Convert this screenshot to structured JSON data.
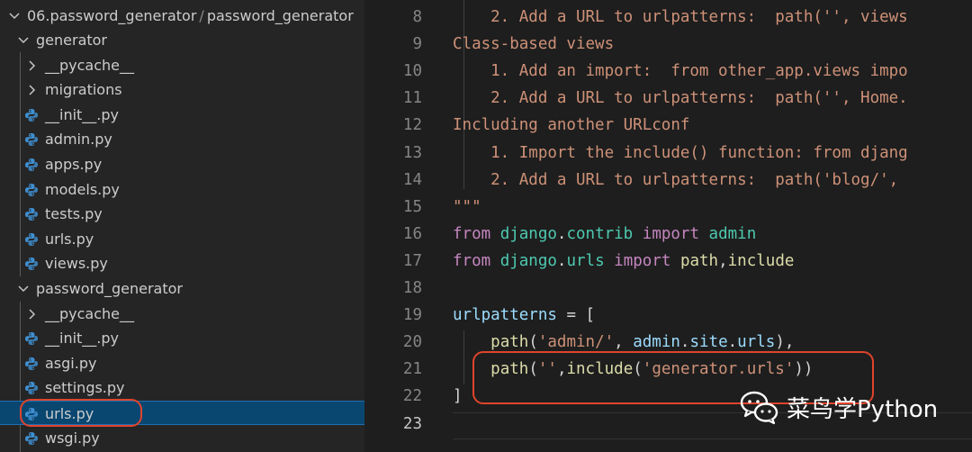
{
  "explorer": {
    "root_label": "06.password_generator",
    "root_label_sep": "/",
    "root_label_tail": "password_generator",
    "items": [
      {
        "label": "generator",
        "kind": "folder-open"
      },
      {
        "label": "__pycache__",
        "kind": "folder-closed"
      },
      {
        "label": "migrations",
        "kind": "folder-closed"
      },
      {
        "label": "__init__.py",
        "kind": "python-file"
      },
      {
        "label": "admin.py",
        "kind": "python-file"
      },
      {
        "label": "apps.py",
        "kind": "python-file"
      },
      {
        "label": "models.py",
        "kind": "python-file"
      },
      {
        "label": "tests.py",
        "kind": "python-file"
      },
      {
        "label": "urls.py",
        "kind": "python-file"
      },
      {
        "label": "views.py",
        "kind": "python-file"
      },
      {
        "label": "password_generator",
        "kind": "folder-open"
      },
      {
        "label": "__pycache__",
        "kind": "folder-closed"
      },
      {
        "label": "__init__.py",
        "kind": "python-file"
      },
      {
        "label": "asgi.py",
        "kind": "python-file"
      },
      {
        "label": "settings.py",
        "kind": "python-file"
      },
      {
        "label": "urls.py",
        "kind": "python-file",
        "selected": true
      },
      {
        "label": "wsgi.py",
        "kind": "python-file"
      }
    ]
  },
  "editor": {
    "lines": [
      {
        "num": "8",
        "t": [
          "    2. Add a URL to urlpatterns:  path('', views"
        ]
      },
      {
        "num": "9",
        "t": [
          "Class-based views"
        ]
      },
      {
        "num": "10",
        "t": [
          "    1. Add an import:  from other_app.views impo"
        ]
      },
      {
        "num": "11",
        "t": [
          "    2. Add a URL to urlpatterns:  path('', Home."
        ]
      },
      {
        "num": "12",
        "t": [
          "Including another URLconf"
        ]
      },
      {
        "num": "13",
        "t": [
          "    1. Import the include() function: from djang"
        ]
      },
      {
        "num": "14",
        "t": [
          "    2. Add a URL to urlpatterns:  path('blog/', "
        ]
      },
      {
        "num": "15",
        "t": [
          "\"\"\""
        ]
      },
      {
        "num": "16",
        "t": [
          "from",
          " ",
          "django",
          ".",
          "contrib",
          " ",
          "import",
          " ",
          "admin"
        ]
      },
      {
        "num": "17",
        "t": [
          "from",
          " ",
          "django",
          ".",
          "urls",
          " ",
          "import",
          " ",
          "path",
          ",",
          "include"
        ]
      },
      {
        "num": "18",
        "t": [
          ""
        ]
      },
      {
        "num": "19",
        "t": [
          "urlpatterns",
          " = ["
        ]
      },
      {
        "num": "20",
        "t": [
          "    ",
          "path",
          "(",
          "'admin/'",
          ", ",
          "admin",
          ".",
          "site",
          ".",
          "urls",
          "),"
        ]
      },
      {
        "num": "21",
        "t": [
          "    ",
          "path",
          "(",
          "''",
          ",",
          "include",
          "(",
          "'generator.urls'",
          "))"
        ]
      },
      {
        "num": "22",
        "t": [
          "]"
        ]
      },
      {
        "num": "23",
        "t": [
          ""
        ]
      }
    ]
  },
  "watermark": {
    "text": "菜鸟学Python"
  },
  "colors": {
    "annotation": "#e0442c",
    "string": "#ce9178",
    "keyword": "#c586c0",
    "module": "#4ec9b0"
  }
}
